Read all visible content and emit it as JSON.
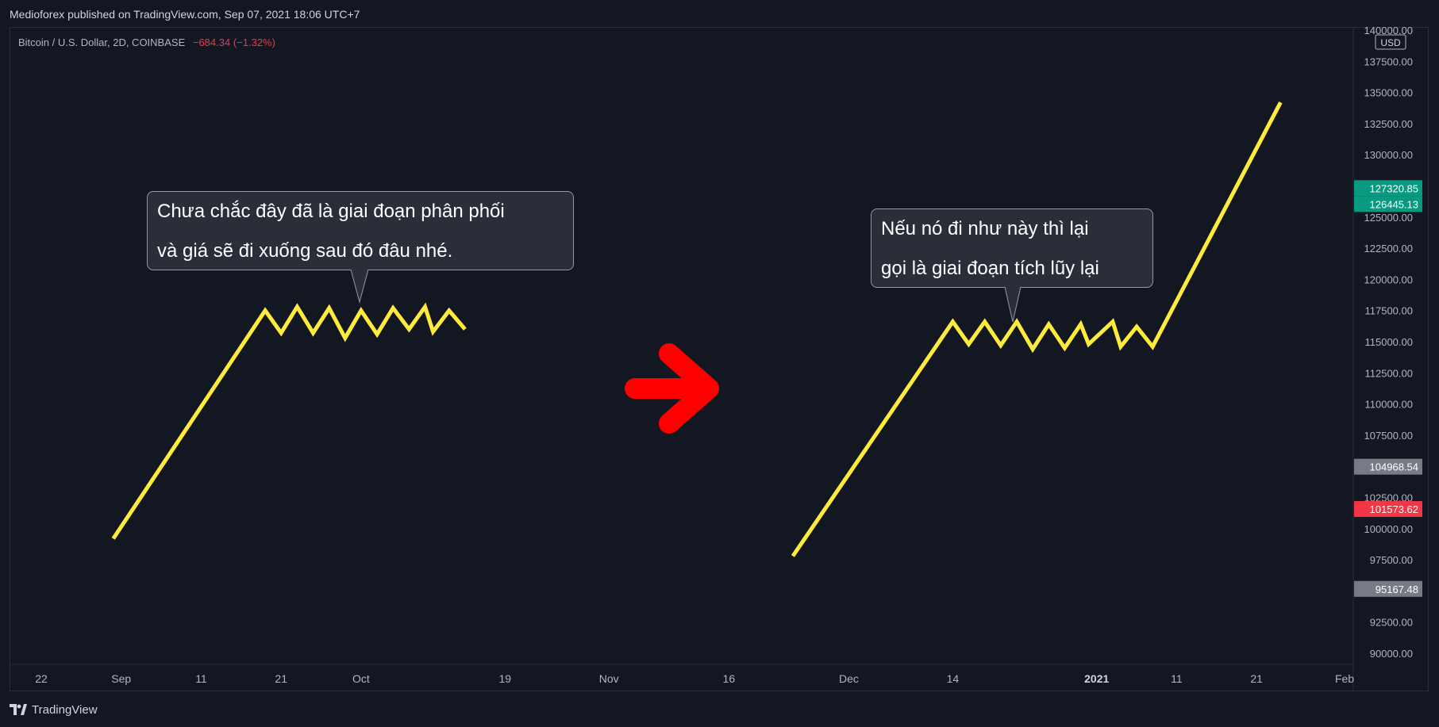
{
  "header": {
    "attribution": "Medioforex published on TradingView.com, Sep 07, 2021 18:06 UTC+7"
  },
  "symbol": {
    "name": "Bitcoin / U.S. Dollar, 2D, COINBASE",
    "change": "−684.34 (−1.32%)"
  },
  "footer": {
    "brand": "TradingView"
  },
  "colors": {
    "line": "#ffeb3b",
    "arrow": "#ff0000",
    "green_badge": "#089981",
    "red_badge": "#f23645",
    "grey_badge": "#787b86"
  },
  "annotations": [
    {
      "lines": [
        "Chưa chắc đây đã là giai đoạn phân phối",
        "và giá sẽ đi xuống sau đó đâu nhé."
      ]
    },
    {
      "lines": [
        "Nếu nó đi như này thì lại",
        "gọi là giai đoạn tích lũy lại"
      ]
    }
  ],
  "chart_data": {
    "type": "line",
    "title": "Bitcoin / U.S. Dollar, 2D, COINBASE",
    "xlabel": "",
    "ylabel": "",
    "y_unit": "USD",
    "ylim": [
      90000,
      140000
    ],
    "y_ticks": [
      "140000.00",
      "137500.00",
      "135000.00",
      "132500.00",
      "130000.00",
      "127500.00",
      "125000.00",
      "122500.00",
      "120000.00",
      "117500.00",
      "115000.00",
      "112500.00",
      "110000.00",
      "107500.00",
      "105000.00",
      "102500.00",
      "100000.00",
      "97500.00",
      "95000.00",
      "92500.00",
      "90000.00"
    ],
    "x_ticks": [
      {
        "label": "22",
        "date": "2020-08-22"
      },
      {
        "label": "Sep",
        "date": "2020-09-01"
      },
      {
        "label": "11",
        "date": "2020-09-11"
      },
      {
        "label": "21",
        "date": "2020-09-21"
      },
      {
        "label": "Oct",
        "date": "2020-10-01"
      },
      {
        "label": "19",
        "date": "2020-10-19"
      },
      {
        "label": "Nov",
        "date": "2020-11-01"
      },
      {
        "label": "16",
        "date": "2020-11-16"
      },
      {
        "label": "Dec",
        "date": "2020-12-01"
      },
      {
        "label": "14",
        "date": "2020-12-14"
      },
      {
        "label": "2021",
        "date": "2021-01-01",
        "bold": true
      },
      {
        "label": "11",
        "date": "2021-01-11"
      },
      {
        "label": "21",
        "date": "2021-01-21"
      },
      {
        "label": "Feb",
        "date": "2021-02-01"
      }
    ],
    "price_badges": [
      {
        "value": "127320.85",
        "color": "green"
      },
      {
        "value": "126445.13",
        "color": "green"
      },
      {
        "value": "104968.54",
        "color": "grey"
      },
      {
        "value": "101573.62",
        "color": "red"
      },
      {
        "value": "95167.48",
        "color": "grey"
      }
    ],
    "series": [
      {
        "points": [
          [
            "2020-08-31",
            99200
          ],
          [
            "2020-09-19",
            117500
          ],
          [
            "2020-09-21",
            115700
          ],
          [
            "2020-09-23",
            117800
          ],
          [
            "2020-09-25",
            115700
          ],
          [
            "2020-09-27",
            117700
          ],
          [
            "2020-09-29",
            115300
          ],
          [
            "2020-10-01",
            117500
          ],
          [
            "2020-10-03",
            115600
          ],
          [
            "2020-10-05",
            117700
          ],
          [
            "2020-10-07",
            116000
          ],
          [
            "2020-10-09",
            117800
          ],
          [
            "2020-10-10",
            115800
          ],
          [
            "2020-10-12",
            117500
          ],
          [
            "2020-10-14",
            116000
          ]
        ]
      },
      {
        "points": [
          [
            "2020-11-24",
            97800
          ],
          [
            "2020-12-14",
            116600
          ],
          [
            "2020-12-16",
            114800
          ],
          [
            "2020-12-18",
            116600
          ],
          [
            "2020-12-20",
            114700
          ],
          [
            "2020-12-22",
            116600
          ],
          [
            "2020-12-24",
            114400
          ],
          [
            "2020-12-26",
            116400
          ],
          [
            "2020-12-28",
            114500
          ],
          [
            "2020-12-30",
            116400
          ],
          [
            "2020-12-31",
            114800
          ],
          [
            "2021-01-03",
            116600
          ],
          [
            "2021-01-04",
            114600
          ],
          [
            "2021-01-06",
            116200
          ],
          [
            "2021-01-08",
            114600
          ],
          [
            "2021-01-24",
            134200
          ]
        ]
      }
    ]
  }
}
